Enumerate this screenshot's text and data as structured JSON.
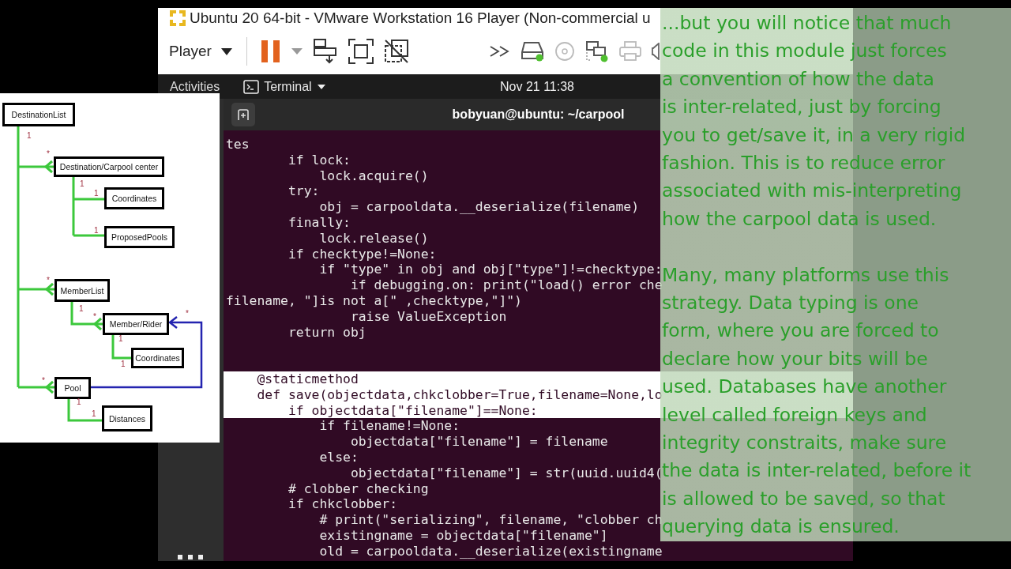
{
  "window": {
    "title": "Ubuntu 20 64-bit - VMware Workstation 16 Player (Non-commercial u"
  },
  "toolbar": {
    "menu": "Player",
    "paused": true
  },
  "ubuntu_bar": {
    "activities": "Activities",
    "app_menu": "Terminal",
    "clock": "Nov 21  11:38"
  },
  "terminal": {
    "title": "bobyuan@ubuntu: ~/carpool",
    "blocks": [
      {
        "lines": [
          {
            "text": "tes",
            "selected": false
          },
          {
            "text": "        if lock:",
            "selected": false
          },
          {
            "text": "            lock.acquire()",
            "selected": false
          },
          {
            "text": "        try:",
            "selected": false
          },
          {
            "text": "            obj = carpooldata.__deserialize(filename)",
            "selected": false
          },
          {
            "text": "        finally:",
            "selected": false
          },
          {
            "text": "            lock.release()",
            "selected": false
          },
          {
            "text": "        if checktype!=None:",
            "selected": false
          },
          {
            "text": "            if \"type\" in obj and obj[\"type\"]!=checktype:",
            "selected": false
          },
          {
            "text": "                if debugging.on: print(\"load() error che",
            "selected": false
          },
          {
            "text": "filename, \"]is not a[\" ,checktype,\"]\")",
            "selected": false
          },
          {
            "text": "                raise ValueException",
            "selected": false
          },
          {
            "text": "        return obj",
            "selected": false
          }
        ]
      },
      {
        "lines": [
          {
            "text": "    @staticmethod",
            "selected": true
          },
          {
            "text": "    def save(objectdata,chkclobber=True,filename=None,lo",
            "selected": true
          },
          {
            "text": "        if objectdata[\"filename\"]==None:",
            "selected": true
          },
          {
            "text": "            if filename!=None:",
            "selected": false
          },
          {
            "text": "                objectdata[\"filename\"] = filename",
            "selected": false
          },
          {
            "text": "            else:",
            "selected": false
          },
          {
            "text": "                objectdata[\"filename\"] = str(uuid.uuid4(",
            "selected": false
          },
          {
            "text": "        # clobber checking",
            "selected": false
          },
          {
            "text": "        if chkclobber:",
            "selected": false
          },
          {
            "text": "            # print(\"serializing\", filename, \"clobber ch",
            "selected": false
          },
          {
            "text": "            existingname = objectdata[\"filename\"]",
            "selected": false
          },
          {
            "text": "            old = carpooldata.__deserialize(existingname",
            "selected": false
          }
        ]
      }
    ]
  },
  "diagram": {
    "classes": [
      "DestinationList",
      "Destination/Carpool center",
      "Coordinates",
      "ProposedPools",
      "MemberList",
      "Member/Rider",
      "Coordinates",
      "Pool",
      "Distances"
    ],
    "multiplicities": [
      "1",
      "*",
      "1",
      "1",
      "1",
      "*",
      "1",
      "*",
      "*",
      "1",
      "1",
      "*",
      "1",
      "1"
    ]
  },
  "note": {
    "paragraphs": [
      {
        "lines": [
          "...but you will notice that much",
          "code in this module just forces",
          "a convention of how the data",
          "is inter-related, just by forcing",
          "you to get/save it, in a very rigid",
          "fashion.  This is to reduce error",
          "associated with mis-interpreting",
          "how the carpool data is used."
        ]
      },
      {
        "lines": [
          "Many, many platforms use this",
          "strategy.  Data typing is one",
          "form, where you are forced to",
          "declare how your bits will be",
          "used.  Databases have another",
          "level called foreign keys and",
          "integrity constraits, make sure",
          "the data is inter-related, before it",
          "is allowed to be saved, so that",
          "querying data is ensured."
        ]
      }
    ]
  }
}
